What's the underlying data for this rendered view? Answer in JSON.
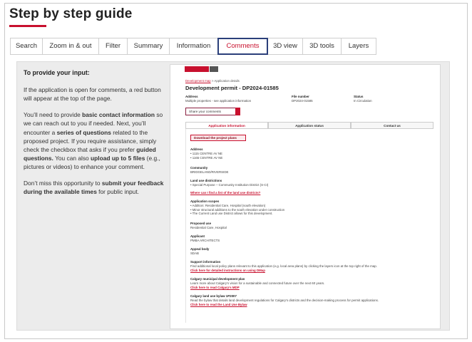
{
  "page": {
    "title": "Step by step guide"
  },
  "tabs": [
    {
      "label": "Search",
      "active": false
    },
    {
      "label": "Zoom in & out",
      "active": false
    },
    {
      "label": "Filter",
      "active": false
    },
    {
      "label": "Summary",
      "active": false
    },
    {
      "label": "Information",
      "active": false
    },
    {
      "label": "Comments",
      "active": true
    },
    {
      "label": "3D view",
      "active": false
    },
    {
      "label": "3D tools",
      "active": false
    },
    {
      "label": "Layers",
      "active": false
    }
  ],
  "colors": {
    "accent": "#c8102e",
    "active_tab_border": "#2b3f7a",
    "panel_bg": "#ececec"
  },
  "instructions": {
    "heading": "To provide your input:",
    "p1": "If the application is open for comments, a red button will appear at the top of the page.",
    "p2_a": "You’ll need to provide ",
    "p2_b": "basic contact information",
    "p2_c": " so we can reach out to you if needed. Next, you’ll encounter a ",
    "p2_d": "series of questions",
    "p2_e": " related to the proposed project. If you require assistance, simply check the checkbox that asks if you prefer ",
    "p2_f": "guided questions.",
    "p2_g": " You can also ",
    "p2_h": "upload up to 5 files",
    "p2_i": " (e.g., pictures or videos) to enhance your comment.",
    "p3_a": "Don’t miss this opportunity to ",
    "p3_b": "submit your feedback during the available times",
    "p3_c": " for public input."
  },
  "screenshot": {
    "breadcrumb_link": "Development map",
    "breadcrumb_sep": " > ",
    "breadcrumb_current": "Application details",
    "title": "Development permit - DP2024-01585",
    "address_label": "Address",
    "address_value": "Multiple properties - see application information",
    "file_label": "File number",
    "file_value": "DP2024-01585",
    "status_label": "Status",
    "status_value": "In Circulation",
    "share_button": "Share your comments",
    "tabs": [
      "Application information",
      "Application status",
      "Contact us"
    ],
    "download_button": "Download the project plans",
    "address_heading": "Address",
    "address_lines": [
      "• 1115 CENTRE AV NE",
      "• 1165 CENTRE AV NE"
    ],
    "community_heading": "Community",
    "community_value": "BRIDGELAND/RIVERSIDE",
    "land_use_heading": "Land use district/ons",
    "land_use_value": "• Special Purpose – Community Institution District (S-CI)",
    "land_use_link": "Where can I find a list of the land use districts?",
    "scope_heading": "Application scopes",
    "scope_lines": [
      "• Addition: Residential Care, Hospital (south elevation)",
      "• Minor structural additions to the south elevation under construction",
      "• The Current Land use District allows for this development."
    ],
    "proposed_heading": "Proposed use",
    "proposed_value": "Residential Care, Hospital",
    "applicant_heading": "Applicant",
    "applicant_value": "PMBA ARCHITECTS",
    "appeal_heading": "Appeal body",
    "appeal_value": "SDAB",
    "support_heading": "Support information",
    "support_text": "Find additional local policy plans relevant to this application (e.g. local area plans) by clicking the layers icon at the top right of the map.",
    "support_link": "Click here for detailed instructions on using DMap",
    "mdp_heading": "Calgary municipal development plan",
    "mdp_text": "Learn more about Calgary’s vision for a sustainable and connected future over the next 60 years.",
    "mdp_link": "Click here to read Calgary’s MDP",
    "bylaw_heading": "Calgary land use bylaw 1P2007",
    "bylaw_text": "Read the bylaw that details land development regulations for Calgary’s districts and the decision-making process for permit applications.",
    "bylaw_link": "Click here to read the Land Use Bylaw"
  }
}
